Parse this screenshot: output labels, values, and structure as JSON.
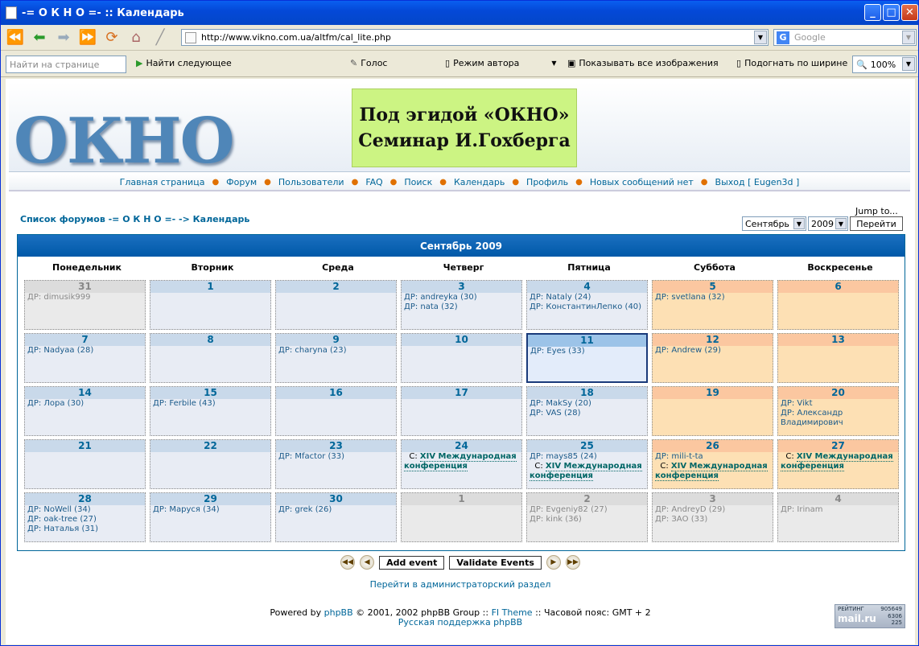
{
  "window": {
    "title": "-= О К Н О =- :: Календарь"
  },
  "browser": {
    "url": "http://www.vikno.com.ua/altfm/cal_lite.php",
    "search_placeholder": "Google"
  },
  "findbar": {
    "find_placeholder": "Найти на странице",
    "find_next": "Найти следующее",
    "voice": "Голос",
    "author_mode": "Режим автора",
    "show_images": "Показывать все изображения",
    "fit_width": "Подогнать по ширине",
    "zoom": "100%"
  },
  "header": {
    "logo": "ОКНО",
    "banner_line1": "Под эгидой «ОКНО»",
    "banner_line2": "Семинар И.Гохберга"
  },
  "menu": [
    "Главная страница",
    "Форум",
    "Пользователи",
    "FAQ",
    "Поиск",
    "Календарь",
    "Профиль",
    "Новых сообщений нет",
    "Выход [ Eugen3d ]"
  ],
  "jump_label": "Jump to...",
  "breadcrumb": "Список форумов -= О К Н О =- -> Календарь",
  "month_select": "Сентябрь",
  "year_select": "2009",
  "go_button": "Перейти",
  "calendar": {
    "title": "Сентябрь 2009",
    "days_of_week": [
      "Понедельник",
      "Вторник",
      "Среда",
      "Четверг",
      "Пятница",
      "Суббота",
      "Воскресенье"
    ],
    "weeks": [
      [
        {
          "d": "31",
          "t": "other",
          "e": [
            "ДР: dimusik999"
          ]
        },
        {
          "d": "1",
          "t": "wk",
          "e": []
        },
        {
          "d": "2",
          "t": "wk",
          "e": []
        },
        {
          "d": "3",
          "t": "wk",
          "e": [
            "ДР: andreyka (30)",
            "ДР: nata (32)"
          ]
        },
        {
          "d": "4",
          "t": "wk",
          "e": [
            "ДР: Nataly (24)",
            "ДР: КонстантинЛепко (40)"
          ]
        },
        {
          "d": "5",
          "t": "we",
          "e": [
            "ДР: svetlana (32)"
          ]
        },
        {
          "d": "6",
          "t": "we",
          "e": []
        }
      ],
      [
        {
          "d": "7",
          "t": "wk",
          "e": [
            "ДР: Nadyaa (28)"
          ]
        },
        {
          "d": "8",
          "t": "wk",
          "e": []
        },
        {
          "d": "9",
          "t": "wk",
          "e": [
            "ДР: charyna (23)"
          ]
        },
        {
          "d": "10",
          "t": "wk",
          "e": []
        },
        {
          "d": "11",
          "t": "today",
          "e": [
            "ДР: Eyes (33)"
          ]
        },
        {
          "d": "12",
          "t": "we",
          "e": [
            "ДР: Andrew (29)"
          ]
        },
        {
          "d": "13",
          "t": "we",
          "e": []
        }
      ],
      [
        {
          "d": "14",
          "t": "wk",
          "e": [
            "ДР: Лора (30)"
          ]
        },
        {
          "d": "15",
          "t": "wk",
          "e": [
            "ДР: Ferbile (43)"
          ]
        },
        {
          "d": "16",
          "t": "wk",
          "e": []
        },
        {
          "d": "17",
          "t": "wk",
          "e": []
        },
        {
          "d": "18",
          "t": "wk",
          "e": [
            "ДР: MakSy (20)",
            "ДР: VAS (28)"
          ]
        },
        {
          "d": "19",
          "t": "we",
          "e": []
        },
        {
          "d": "20",
          "t": "we",
          "e": [
            "ДР: Vikt",
            "ДР: Александр Владимирович"
          ]
        }
      ],
      [
        {
          "d": "21",
          "t": "wk",
          "e": []
        },
        {
          "d": "22",
          "t": "wk",
          "e": []
        },
        {
          "d": "23",
          "t": "wk",
          "e": [
            "ДР: Mfactor (33)"
          ]
        },
        {
          "d": "24",
          "t": "wk",
          "e": [],
          "c": "XIV Международная конференция"
        },
        {
          "d": "25",
          "t": "wk",
          "e": [
            "ДР: mays85 (24)"
          ],
          "c": "XIV Международная конференция"
        },
        {
          "d": "26",
          "t": "we",
          "e": [
            "ДР: mili-t-ta"
          ],
          "c": "XIV Международная конференция"
        },
        {
          "d": "27",
          "t": "we",
          "e": [],
          "c": "XIV Международная конференция"
        }
      ],
      [
        {
          "d": "28",
          "t": "wk",
          "e": [
            "ДР: NoWell (34)",
            "ДР: oak-tree (27)",
            "ДР: Наталья (31)"
          ]
        },
        {
          "d": "29",
          "t": "wk",
          "e": [
            "ДР: Маруся (34)"
          ]
        },
        {
          "d": "30",
          "t": "wk",
          "e": [
            "ДР: grek (26)"
          ]
        },
        {
          "d": "1",
          "t": "other",
          "e": []
        },
        {
          "d": "2",
          "t": "other",
          "e": [
            "ДР: Evgeniy82 (27)",
            "ДР: kink (36)"
          ]
        },
        {
          "d": "3",
          "t": "other",
          "e": [
            "ДР: AndreyD (29)",
            "ДР: ЗАО (33)"
          ]
        },
        {
          "d": "4",
          "t": "other",
          "e": [
            "ДР: Irinam"
          ]
        }
      ]
    ]
  },
  "buttons": {
    "add_event": "Add event",
    "validate_events": "Validate Events"
  },
  "admin_link": "Перейти в администраторский раздел",
  "footer": {
    "powered": "Powered by",
    "phpbb": "phpBB",
    "copy": "© 2001, 2002 phpBB Group ::",
    "theme": "FI Theme",
    "tz": ":: Часовой пояс: GMT + 2",
    "support": "Русская поддержка phpBB"
  },
  "rating": {
    "label": "РЕЙТИНГ",
    "n1": "905649",
    "n2": "6306",
    "n3": "225",
    "brand": "mail.ru"
  }
}
